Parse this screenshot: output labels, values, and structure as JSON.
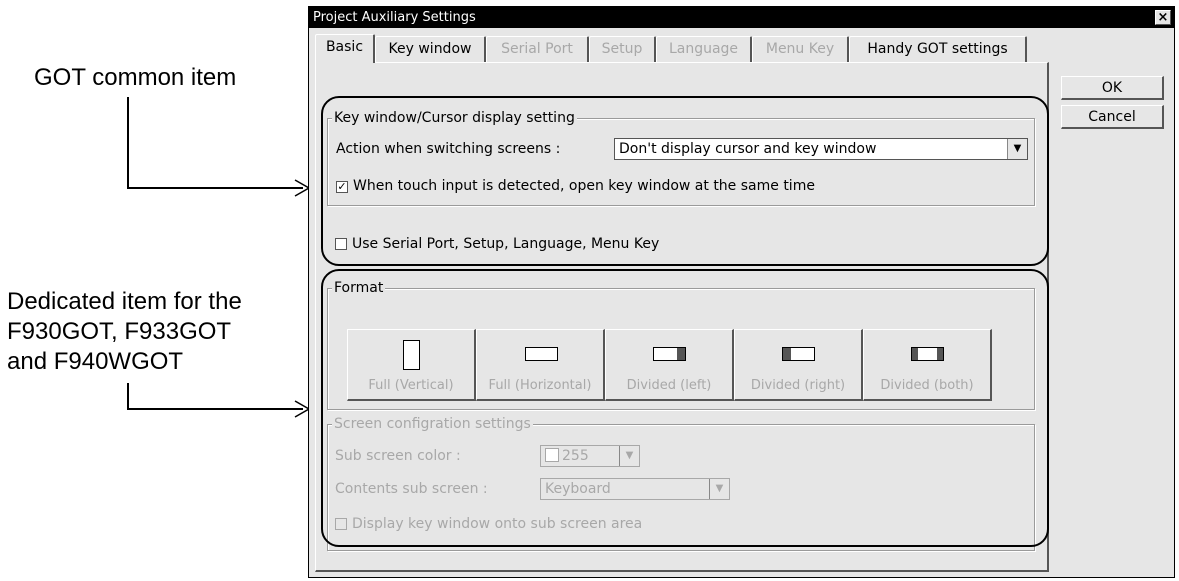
{
  "annotations": {
    "common_line1": "GOT common item",
    "dedicated_line1": "Dedicated item for the",
    "dedicated_line2": "F930GOT, F933GOT",
    "dedicated_line3": "and F940WGOT"
  },
  "dialog": {
    "title": "Project Auxiliary Settings",
    "close_label": "×",
    "tabs": [
      {
        "label": "Basic",
        "state": "active"
      },
      {
        "label": "Key window",
        "state": "enabled"
      },
      {
        "label": "Serial Port",
        "state": "disabled"
      },
      {
        "label": "Setup",
        "state": "disabled"
      },
      {
        "label": "Language",
        "state": "disabled"
      },
      {
        "label": "Menu Key",
        "state": "disabled"
      },
      {
        "label": "Handy GOT settings",
        "state": "enabled"
      }
    ],
    "ok_label": "OK",
    "cancel_label": "Cancel"
  },
  "key_window_group": {
    "legend": "Key window/Cursor display setting",
    "action_label": "Action when switching screens :",
    "action_value": "Don't display cursor and key window",
    "touch_check": true,
    "touch_label": "When touch input is detected, open key window at the same time"
  },
  "use_serial": {
    "checked": false,
    "label": "Use Serial Port, Setup, Language, Menu Key"
  },
  "format_group": {
    "legend": "Format",
    "buttons": [
      {
        "label": "Full (Vertical)",
        "icon": "format-full-vertical-icon"
      },
      {
        "label": "Full (Horizontal)",
        "icon": "format-full-horizontal-icon"
      },
      {
        "label": "Divided (left)",
        "icon": "format-divided-left-icon"
      },
      {
        "label": "Divided (right)",
        "icon": "format-divided-right-icon"
      },
      {
        "label": "Divided (both)",
        "icon": "format-divided-both-icon"
      }
    ]
  },
  "screen_config": {
    "legend": "Screen configration settings",
    "sub_color_label": "Sub screen color :",
    "sub_color_value": "255",
    "contents_label": "Contents sub screen :",
    "contents_value": "Keyboard",
    "display_key_label": "Display key window onto sub screen area",
    "display_key_checked": false
  },
  "colors": {
    "dialog_bg": "#e6e6e6",
    "titlebar": "#000000",
    "disabled_text": "#a8a8a8"
  }
}
